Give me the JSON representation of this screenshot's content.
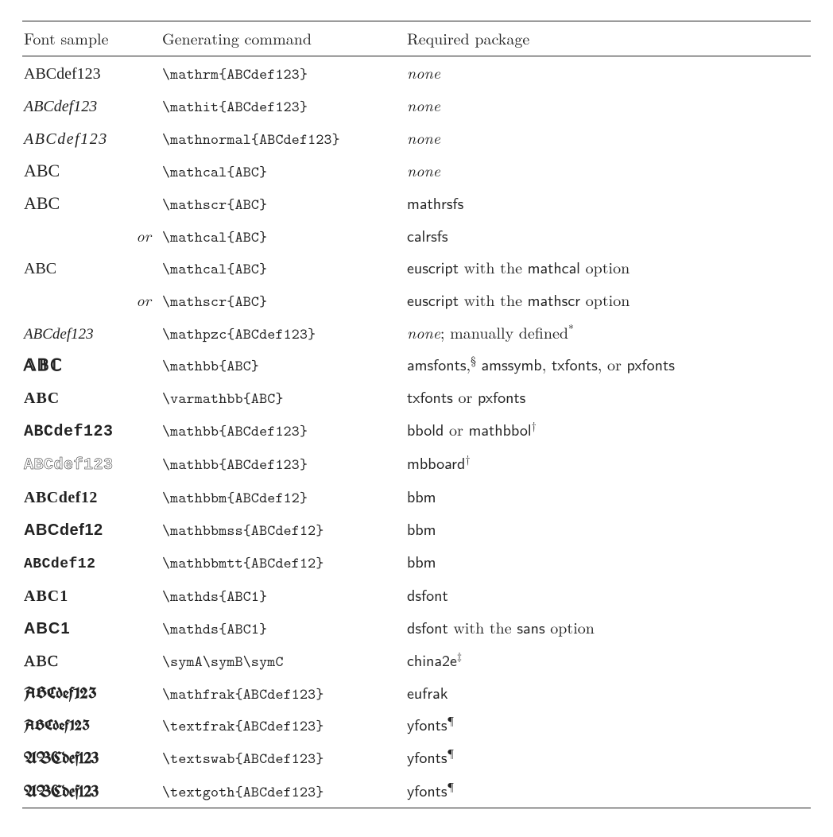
{
  "chart_data": {
    "type": "table",
    "columns": [
      "Font sample",
      "Generating command",
      "Required package"
    ],
    "rows": [
      {
        "sample": "ABCdef123",
        "command": "\\mathrm{ABCdef123}",
        "package": "none"
      },
      {
        "sample": "ABCdef123",
        "command": "\\mathit{ABCdef123}",
        "package": "none"
      },
      {
        "sample": "ABCdef123",
        "command": "\\mathnormal{ABCdef123}",
        "package": "none"
      },
      {
        "sample": "ABC",
        "command": "\\mathcal{ABC}",
        "package": "none"
      },
      {
        "sample": "ABC",
        "command": "\\mathscr{ABC}",
        "package": "mathrsfs"
      },
      {
        "sample": "or",
        "command": "\\mathcal{ABC}",
        "package": "calrsfs"
      },
      {
        "sample": "ABC",
        "command": "\\mathcal{ABC}",
        "package": "euscript with the mathcal option"
      },
      {
        "sample": "or",
        "command": "\\mathscr{ABC}",
        "package": "euscript with the mathscr option"
      },
      {
        "sample": "ABCdef123",
        "command": "\\mathpzc{ABCdef123}",
        "package": "none; manually defined*"
      },
      {
        "sample": "𝔸𝔹ℂ",
        "command": "\\mathbb{ABC}",
        "package": "amsfonts,§ amssymb, txfonts, or pxfonts"
      },
      {
        "sample": "ABC",
        "command": "\\varmathbb{ABC}",
        "package": "txfonts or pxfonts"
      },
      {
        "sample": "ABCdef123",
        "command": "\\mathbb{ABCdef123}",
        "package": "bbold or mathbbol†"
      },
      {
        "sample": "ABCdef123",
        "command": "\\mathbb{ABCdef123}",
        "package": "mbboard†"
      },
      {
        "sample": "ABCdef12",
        "command": "\\mathbbm{ABCdef12}",
        "package": "bbm"
      },
      {
        "sample": "ABCdef12",
        "command": "\\mathbbmss{ABCdef12}",
        "package": "bbm"
      },
      {
        "sample": "ABCdef12",
        "command": "\\mathbbmtt{ABCdef12}",
        "package": "bbm"
      },
      {
        "sample": "ABC1",
        "command": "\\mathds{ABC1}",
        "package": "dsfont"
      },
      {
        "sample": "ABC1",
        "command": "\\mathds{ABC1}",
        "package": "dsfont with the sans option"
      },
      {
        "sample": "ABC",
        "command": "\\symA\\symB\\symC",
        "package": "china2e‡"
      },
      {
        "sample": "ABCdef123",
        "command": "\\mathfrak{ABCdef123}",
        "package": "eufrak"
      },
      {
        "sample": "ABCdef123",
        "command": "\\textfrak{ABCdef123}",
        "package": "yfonts¶"
      },
      {
        "sample": "ABCdef123",
        "command": "\\textswab{ABCdef123}",
        "package": "yfonts¶"
      },
      {
        "sample": "ABCdef123",
        "command": "\\textgoth{ABCdef123}",
        "package": "yfonts¶"
      }
    ]
  },
  "head": {
    "c0": "Font sample",
    "c1": "Generating command",
    "c2": "Required package"
  },
  "w_or": "or",
  "w_none": "none",
  "w_with_the": " with the ",
  "w_option": " option",
  "w_or_word": " or ",
  "w_manual": "; manually defined",
  "s": {
    "rm": "ABCdef123",
    "it": "ABCdef123",
    "norm": "ABCdef123",
    "cal": "ABC",
    "scr": "ABC",
    "eus": "ABC",
    "pzc": "ABCdef123",
    "bb": "𝔸𝔹ℂ",
    "varbb": "ABC",
    "bbold": "ABCdef123",
    "mbb": "ABCdef123",
    "bbm": "ABCdef12",
    "bbmss": "ABCdef12",
    "bbmtt": "ABCdef12",
    "ds": "ABC1",
    "dss": "ABC1",
    "cn": "ABC",
    "frak": "ABCdef123",
    "frak2": "ABCdef123",
    "swab": "ABCdef123",
    "goth": "ABCdef123"
  },
  "c": {
    "rm": "\\mathrm{ABCdef123}",
    "it": "\\mathit{ABCdef123}",
    "norm": "\\mathnormal{ABCdef123}",
    "cal": "\\mathcal{ABC}",
    "scr": "\\mathscr{ABC}",
    "pzc": "\\mathpzc{ABCdef123}",
    "bb": "\\mathbb{ABC}",
    "varbb": "\\varmathbb{ABC}",
    "bbfull": "\\mathbb{ABCdef123}",
    "bbm": "\\mathbbm{ABCdef12}",
    "bbmss": "\\mathbbmss{ABCdef12}",
    "bbmtt": "\\mathbbmtt{ABCdef12}",
    "ds": "\\mathds{ABC1}",
    "sym": "\\symA\\symB\\symC",
    "frak": "\\mathfrak{ABCdef123}",
    "tfrak": "\\textfrak{ABCdef123}",
    "tswab": "\\textswab{ABCdef123}",
    "tgoth": "\\textgoth{ABCdef123}"
  },
  "p": {
    "mathrsfs": "mathrsfs",
    "calrsfs": "calrsfs",
    "euscript": "euscript",
    "mathcal": "mathcal",
    "mathscr": "mathscr",
    "amsfonts": "amsfonts",
    "amssymb": "amssymb",
    "txfonts": "txfonts",
    "pxfonts": "pxfonts",
    "bbold": "bbold",
    "mathbbol": "mathbbol",
    "mbboard": "mbboard",
    "bbm": "bbm",
    "dsfont": "dsfont",
    "sans": "sans",
    "china2e": "china2e",
    "eufrak": "eufrak",
    "yfonts": "yfonts"
  },
  "fn": {
    "ast": "*",
    "sect": "§",
    "dag": "†",
    "ddag": "‡",
    "para": "¶"
  },
  "sep": {
    "comma": ",",
    "comma_sp": ", "
  }
}
